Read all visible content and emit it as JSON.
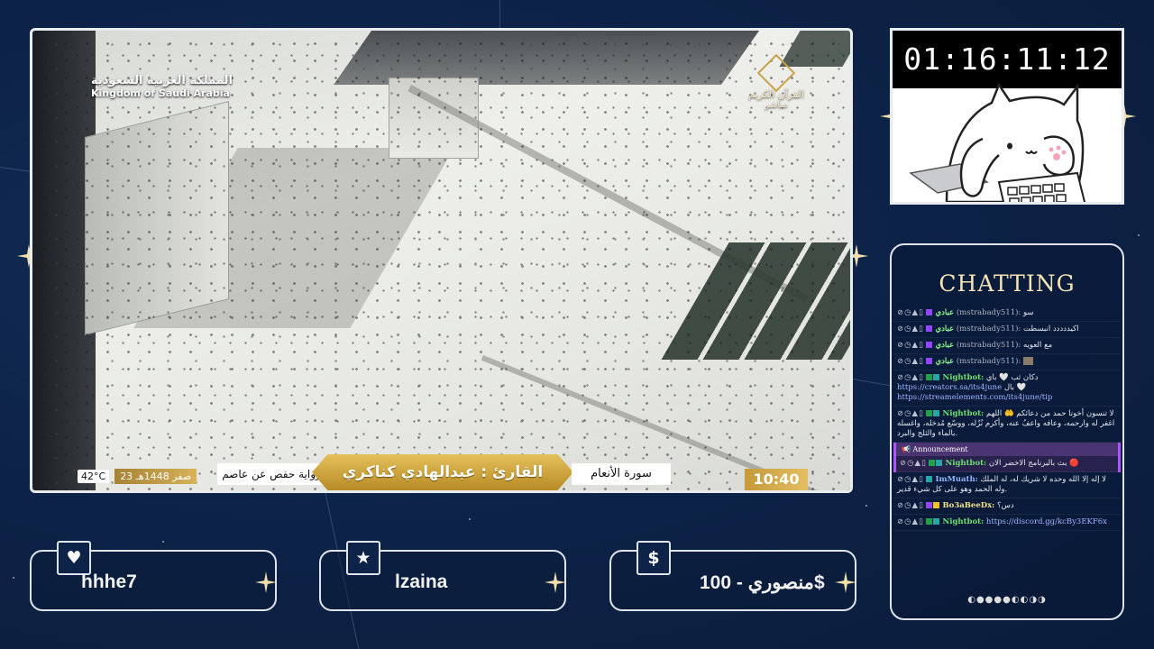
{
  "stream": {
    "overlay_watermark": {
      "country_ar": "المملكة العربية السعودية",
      "country_en": "Kingdom of Saudi Arabia",
      "channel_ar": "القرآن الكريم",
      "live_ar": "مباشر"
    },
    "lower_third": {
      "temperature": "42°C",
      "date": "23 صفر 1448هـ",
      "riwaya": "رواية حفص عن عاصم",
      "reciter": "القارئ : عبدالهادي كناكري",
      "surah": "سورة الأنعام",
      "time": "10:40"
    }
  },
  "cam": {
    "timer": "01:16:11:12"
  },
  "chat": {
    "title": "CHATTING",
    "messages": [
      {
        "user": "عبادي",
        "handle": "(mstrabady511):",
        "text": "سو"
      },
      {
        "user": "عبادي",
        "handle": "(mstrabady511):",
        "text": "اكيددددد انبسطت"
      },
      {
        "user": "عبادي",
        "handle": "(mstrabady511):",
        "text": "مع العويه"
      },
      {
        "user": "عبادي",
        "handle": "(mstrabady511):",
        "text": ""
      },
      {
        "user": "Nightbot:",
        "text": "دكان ثب 🤍 باي",
        "link1": "https://creators.sa/its4june",
        "text2": "بال 🤍",
        "link2": "https://streamelements.com/its4june/tip"
      },
      {
        "user": "Nightbot:",
        "text": "لا تنسون أخونا حمد من دعائكم 🤲 اللهم اغفر له وارحمه، وعافه واعفُ عنه، وأكرم نُزُله، ووسّع مُدخله، واغسله بالماء والثلج والبرد."
      },
      {
        "announcement": "Announcement",
        "user": "Nightbot:",
        "text": "بث بالبرنامج الاخضر الان 🔴"
      },
      {
        "user": "ImMuath:",
        "text": "لا إله إلا الله وحده لا شريك له، له الملك وله الحمد وهو على كل شيء قدير."
      },
      {
        "user": "Bo3aBeeDx:",
        "text": "دس؟"
      },
      {
        "user": "Nightbot:",
        "link": "https://discord.gg/kcBy3EKF6x"
      }
    ],
    "pager": "◐●●●●◐◐◑◑"
  },
  "alerts": [
    {
      "icon": "heart-icon",
      "symbol": "♥",
      "name": "hhhe7"
    },
    {
      "icon": "star-icon",
      "symbol": "★",
      "name": "lzaina"
    },
    {
      "icon": "dollar-icon",
      "symbol": "$",
      "name": "منصوري - 100$"
    }
  ],
  "colors": {
    "background": "#0d2348",
    "frame": "#e9ecef",
    "gold": "#d7b25a",
    "chat_title": "#f4e3b5"
  }
}
